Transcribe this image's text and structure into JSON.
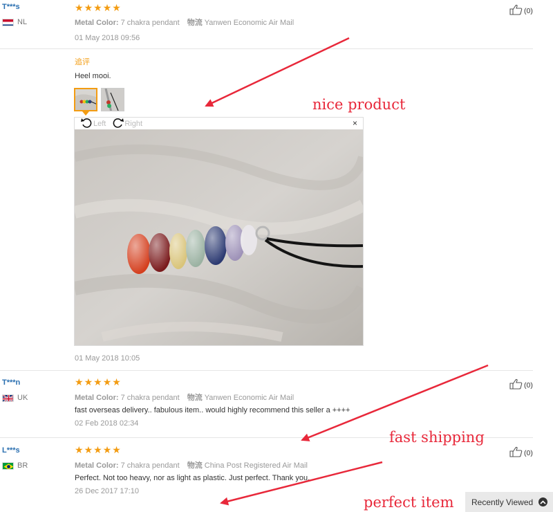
{
  "reviews": [
    {
      "name": "T***s",
      "country": "NL",
      "metal_label": "Metal Color:",
      "metal_value": "7 chakra pendant",
      "shipping_label": "物流",
      "shipping_value": "Yanwen Economic Air Mail",
      "date": "01 May 2018 09:56",
      "helpful": "(0)",
      "followup_title": "追评",
      "followup_text": "Heel mooi.",
      "followup_date": "01 May 2018 10:05"
    },
    {
      "name": "T***n",
      "country": "UK",
      "metal_label": "Metal Color:",
      "metal_value": "7 chakra pendant",
      "shipping_label": "物流",
      "shipping_value": "Yanwen Economic Air Mail",
      "text": "fast overseas delivery.. fabulous item.. would highly recommend this seller a ++++",
      "date": "02 Feb 2018 02:34",
      "helpful": "(0)"
    },
    {
      "name": "L***s",
      "country": "BR",
      "metal_label": "Metal Color:",
      "metal_value": "7 chakra pendant",
      "shipping_label": "物流",
      "shipping_value": "China Post Registered Air Mail",
      "text": "Perfect. Not too heavy, nor as light as plastic. Just perfect. Thank you.",
      "date": "26 Dec 2017 17:10",
      "helpful": "(0)"
    }
  ],
  "viewer": {
    "rotate_left": "Left",
    "rotate_right": "Right",
    "close": "×"
  },
  "annotations": {
    "a1": "nice product",
    "a2": "fast shipping",
    "a3": "perfect item"
  },
  "recently_viewed": "Recently Viewed",
  "colors": {
    "star": "#f39c12",
    "name": "#2a6fb0",
    "annotation": "#e8283a",
    "followup": "#f39c12"
  }
}
